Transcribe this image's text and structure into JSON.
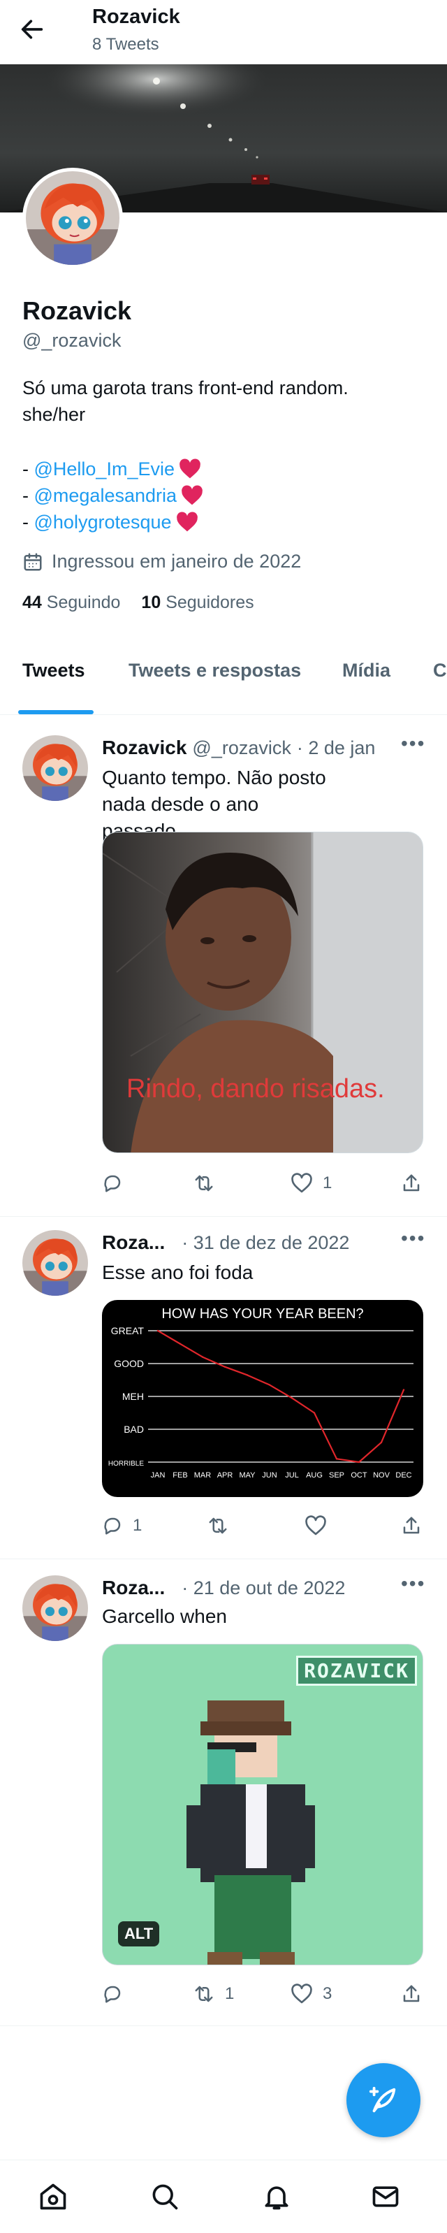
{
  "header": {
    "name": "Rozavick",
    "tweet_count": "8 Tweets"
  },
  "profile": {
    "name": "Rozavick",
    "handle": "@_rozavick",
    "bio_line1": "Só uma garota trans front-end random.",
    "bio_line2": "she/her",
    "mentions": [
      {
        "prefix": "- ",
        "handle": "@Hello_Im_Evie"
      },
      {
        "prefix": "- ",
        "handle": "@megalesandria"
      },
      {
        "prefix": "- ",
        "handle": "@holygrotesque"
      }
    ],
    "joined": "Ingressou em janeiro de 2022",
    "following_count": "44",
    "following_label": "Seguindo",
    "followers_count": "10",
    "followers_label": "Seguidores"
  },
  "tabs": [
    "Tweets",
    "Tweets e respostas",
    "Mídia",
    "C"
  ],
  "tweets": [
    {
      "name": "Rozavick",
      "handle": "@_rozavick",
      "date": "· 2 de jan",
      "text": "Quanto tempo. Não posto nada desde o ano passado",
      "image_caption": "Rindo, dando risadas.",
      "replies": "",
      "retweets": "",
      "likes": "1"
    },
    {
      "name": "Roza...",
      "handle": "",
      "date": "· 31 de dez de 2022",
      "text": "Esse ano foi foda",
      "replies": "1",
      "retweets": "",
      "likes": ""
    },
    {
      "name": "Roza...",
      "handle": "",
      "date": "· 21 de out de 2022",
      "text": "Garcello when",
      "image_badge": "ROZAVICK",
      "alt_label": "ALT",
      "replies": "",
      "retweets": "1",
      "likes": "3"
    }
  ],
  "chart_data": {
    "type": "line",
    "title": "HOW HAS YOUR YEAR BEEN?",
    "categories": [
      "JAN",
      "FEB",
      "MAR",
      "APR",
      "MAY",
      "JUN",
      "JUL",
      "AUG",
      "SEP",
      "OCT",
      "NOV",
      "DEC"
    ],
    "y_categories": [
      "HORRIBLE",
      "BAD",
      "MEH",
      "GOOD",
      "GREAT"
    ],
    "series": [
      {
        "values": [
          4.0,
          3.6,
          3.2,
          2.9,
          2.65,
          2.35,
          1.95,
          1.5,
          0.1,
          0.0,
          0.6,
          2.2
        ]
      }
    ],
    "ylim": [
      0,
      4
    ],
    "grid": true,
    "colors": {
      "background": "#000000",
      "line": "#e0262b",
      "grid": "#ffffff",
      "text": "#ffffff"
    }
  },
  "fab_icon": "compose-tweet-icon",
  "bottom_nav": [
    "home-icon",
    "search-icon",
    "notifications-icon",
    "messages-icon"
  ],
  "colors": {
    "accent": "#1d9bf0",
    "heart": "#e0245e",
    "text": "#0f1419",
    "muted": "#536471"
  }
}
